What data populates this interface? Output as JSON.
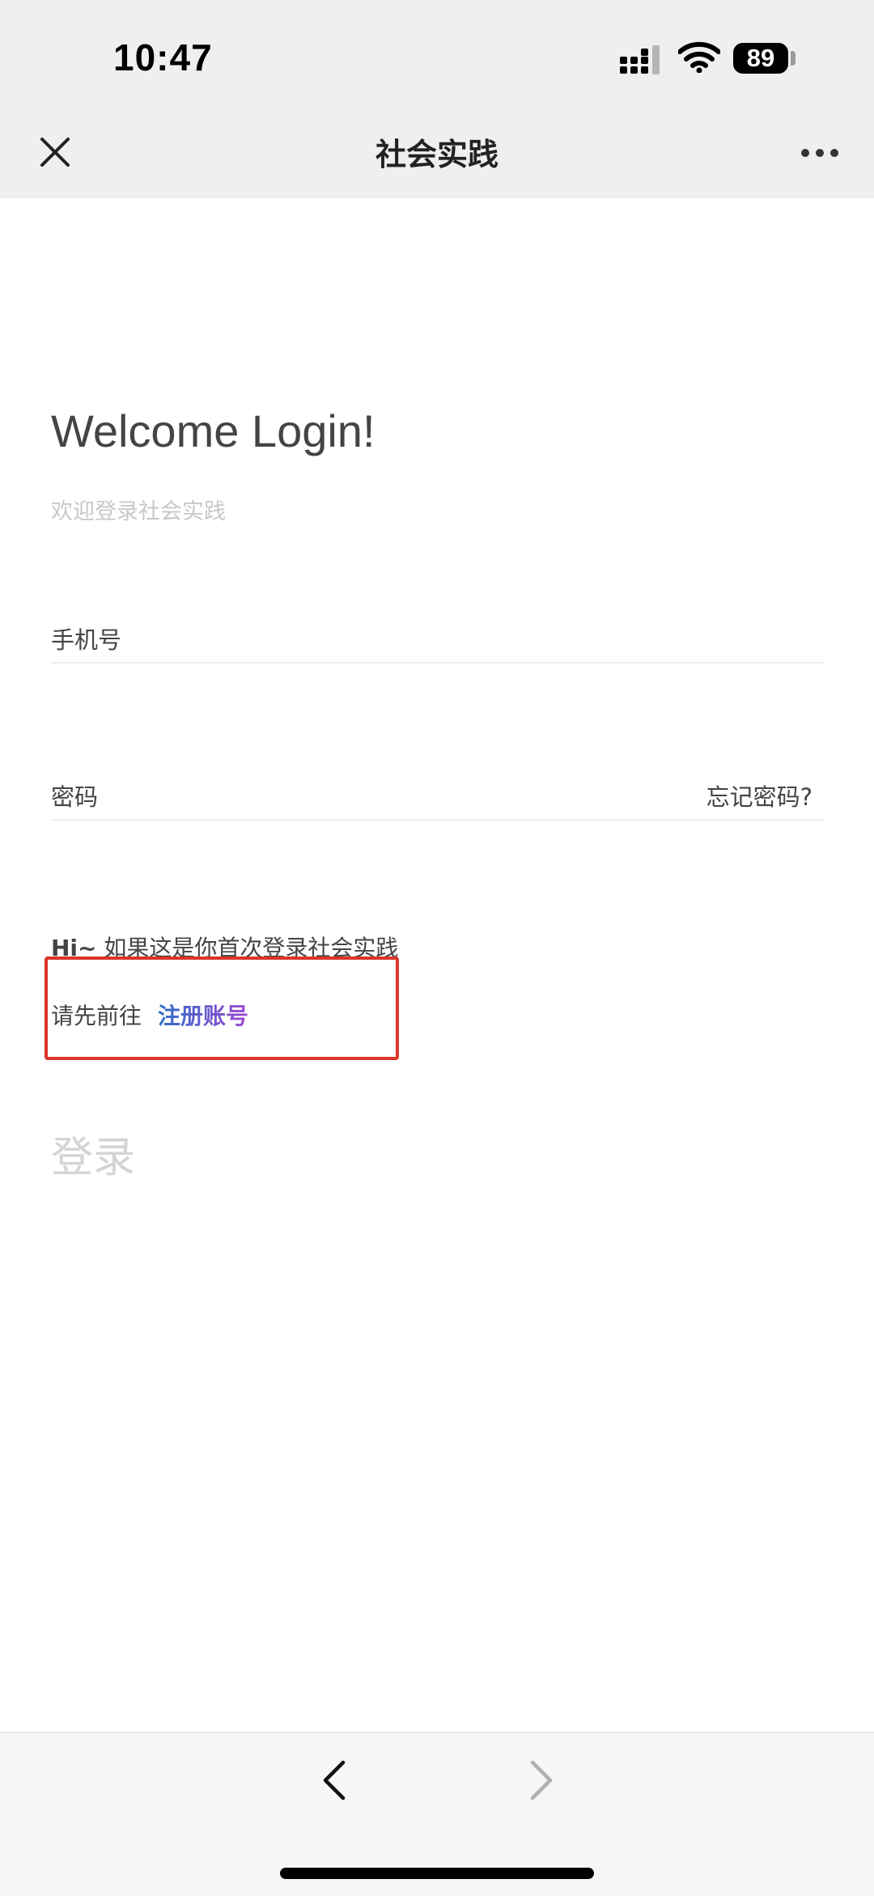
{
  "status_bar": {
    "time": "10:47",
    "battery": "89",
    "icons": [
      "signal-icon",
      "wifi-icon",
      "battery-icon"
    ]
  },
  "nav": {
    "title": "社会实践",
    "icons": [
      "close-icon",
      "more-icon"
    ]
  },
  "login": {
    "welcome": "Welcome Login!",
    "subtitle": "欢迎登录社会实践",
    "phone_label": "手机号",
    "password_label": "密码",
    "forgot_password": "忘记密码?",
    "hi_prefix": "Hi~",
    "hi_text": " 如果这是你首次登录社会实践",
    "register_prompt": "请先前往",
    "register_link": "注册账号",
    "login_button": "登录"
  },
  "bottom_nav": {
    "icons": [
      "back-arrow-icon",
      "forward-arrow-icon"
    ]
  },
  "colors": {
    "highlight_border": "#d9362b",
    "link_gradient_start": "#2f6fc8",
    "link_gradient_end": "#9b46d3",
    "login_disabled": "#d4d4d4"
  }
}
